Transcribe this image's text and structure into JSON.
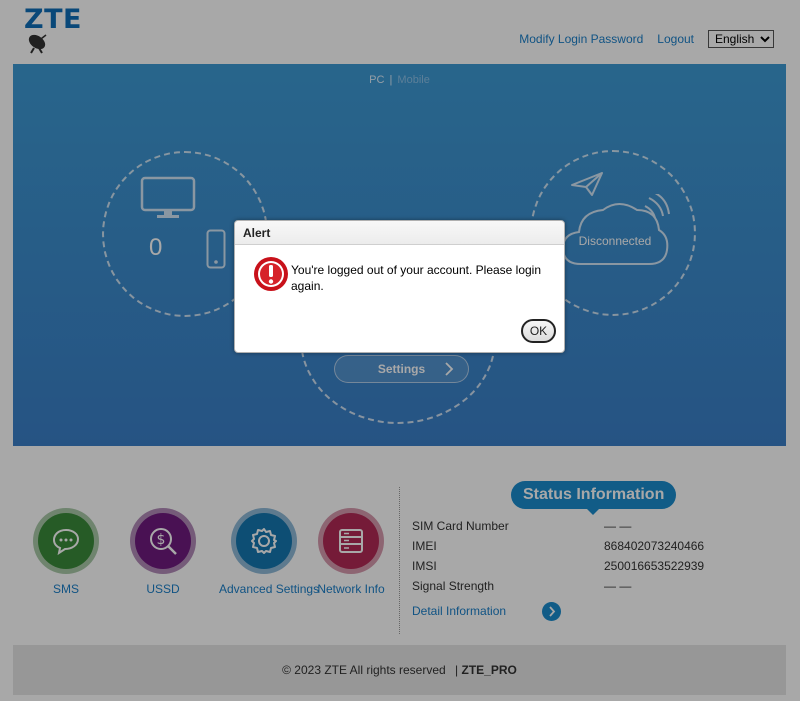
{
  "header": {
    "logo": "ZTE",
    "modify_password": "Modify Login Password",
    "logout": "Logout",
    "language": "English"
  },
  "hero": {
    "view_pc": "PC",
    "view_separator": "|",
    "view_mobile": "Mobile",
    "device_count": "0",
    "connection_status": "Disconnected",
    "settings_label": "Settings"
  },
  "quick_actions": [
    {
      "label": "SMS",
      "icon": "message-icon",
      "color": "#3b8a3a"
    },
    {
      "label": "USSD",
      "icon": "dollar-search-icon",
      "color": "#6f1a7e"
    },
    {
      "label": "Advanced Settings",
      "icon": "gear-icon",
      "color": "#1577b0"
    },
    {
      "label": "Network Info",
      "icon": "server-icon",
      "color": "#b22a55"
    }
  ],
  "status": {
    "title": "Status Information",
    "rows": [
      {
        "key": "SIM Card Number",
        "value": "— —"
      },
      {
        "key": "IMEI",
        "value": "868402073240466"
      },
      {
        "key": "IMSI",
        "value": "250016653522939"
      },
      {
        "key": "Signal Strength",
        "value": "— —"
      }
    ],
    "detail_link": "Detail Information"
  },
  "footer": {
    "copyright": "© 2023 ZTE All rights reserved",
    "separator": "|",
    "model": "ZTE_PRO"
  },
  "dialog": {
    "title": "Alert",
    "message": "You're logged out of your account. Please login again.",
    "ok_label": "OK",
    "icon": "error-icon"
  }
}
